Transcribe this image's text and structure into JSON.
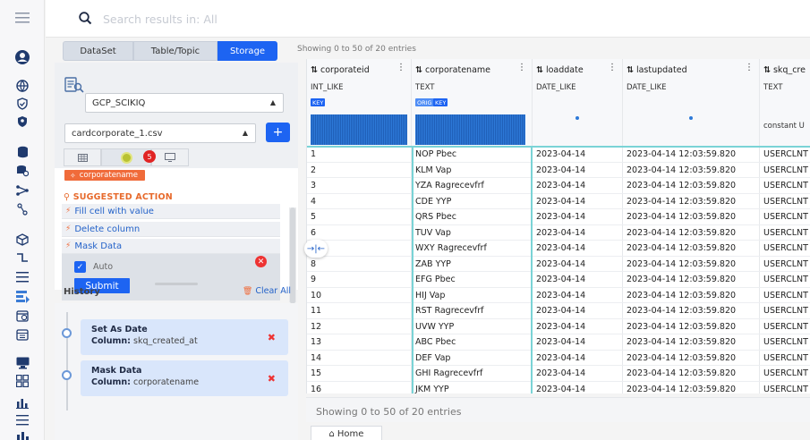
{
  "search": {
    "placeholder": "Search results in: All"
  },
  "panel_tabs": [
    {
      "label": "DataSet",
      "active": false
    },
    {
      "label": "Table/Topic",
      "active": false
    },
    {
      "label": "Storage",
      "active": true
    }
  ],
  "config": {
    "project": "GCP_SCIKIQ",
    "file": "cardcorporate_1.csv",
    "add_label": "+",
    "alert_count": "5"
  },
  "selected_column_chip": "corporatename",
  "suggested_action": {
    "title": "SUGGESTED ACTION",
    "actions": [
      "Fill cell with value",
      "Delete column",
      "Mask Data"
    ],
    "auto_label": "Auto",
    "submit_label": "Submit"
  },
  "history": {
    "title": "History",
    "clear_label": "Clear All",
    "items": [
      {
        "title": "Set As Date",
        "column_label": "Column:",
        "column": "skq_created_at"
      },
      {
        "title": "Mask Data",
        "column_label": "Column:",
        "column": "corporatename"
      }
    ]
  },
  "table": {
    "showing_top": "Showing 0 to 50 of 20 entries",
    "showing_bottom": "Showing 0 to 50 of 20 entries",
    "columns": [
      {
        "name": "corporateid",
        "type": "INT_LIKE",
        "keys": [
          "KEY"
        ]
      },
      {
        "name": "corporatename",
        "type": "TEXT",
        "keys": [
          "ORIG",
          "KEY"
        ]
      },
      {
        "name": "loaddate",
        "type": "DATE_LIKE",
        "keys": []
      },
      {
        "name": "lastupdated",
        "type": "DATE_LIKE",
        "keys": []
      },
      {
        "name": "skq_cre",
        "type": "TEXT",
        "keys": [],
        "profile_text": "constant U"
      }
    ],
    "rows": [
      [
        "1",
        "NOP Pbec",
        "2023-04-14",
        "2023-04-14 12:03:59.820",
        "USERCLNT"
      ],
      [
        "2",
        "KLM Vap",
        "2023-04-14",
        "2023-04-14 12:03:59.820",
        "USERCLNT"
      ],
      [
        "3",
        "YZA Ragrecevfrf",
        "2023-04-14",
        "2023-04-14 12:03:59.820",
        "USERCLNT"
      ],
      [
        "4",
        "CDE YYP",
        "2023-04-14",
        "2023-04-14 12:03:59.820",
        "USERCLNT"
      ],
      [
        "5",
        "QRS Pbec",
        "2023-04-14",
        "2023-04-14 12:03:59.820",
        "USERCLNT"
      ],
      [
        "6",
        "TUV Vap",
        "2023-04-14",
        "2023-04-14 12:03:59.820",
        "USERCLNT"
      ],
      [
        "7",
        "WXY Ragrecevfrf",
        "2023-04-14",
        "2023-04-14 12:03:59.820",
        "USERCLNT"
      ],
      [
        "8",
        "ZAB YYP",
        "2023-04-14",
        "2023-04-14 12:03:59.820",
        "USERCLNT"
      ],
      [
        "9",
        "EFG Pbec",
        "2023-04-14",
        "2023-04-14 12:03:59.820",
        "USERCLNT"
      ],
      [
        "10",
        "HIJ Vap",
        "2023-04-14",
        "2023-04-14 12:03:59.820",
        "USERCLNT"
      ],
      [
        "11",
        "RST Ragrecevfrf",
        "2023-04-14",
        "2023-04-14 12:03:59.820",
        "USERCLNT"
      ],
      [
        "12",
        "UVW YYP",
        "2023-04-14",
        "2023-04-14 12:03:59.820",
        "USERCLNT"
      ],
      [
        "13",
        "ABC Pbec",
        "2023-04-14",
        "2023-04-14 12:03:59.820",
        "USERCLNT"
      ],
      [
        "14",
        "DEF Vap",
        "2023-04-14",
        "2023-04-14 12:03:59.820",
        "USERCLNT"
      ],
      [
        "15",
        "GHI Ragrecevfrf",
        "2023-04-14",
        "2023-04-14 12:03:59.820",
        "USERCLNT"
      ],
      [
        "16",
        "JKM YYP",
        "2023-04-14",
        "2023-04-14 12:03:59.820",
        "USERCLNT"
      ]
    ]
  },
  "bottom_tab": {
    "label": "Home"
  },
  "rail_icons": [
    "menu-icon",
    "user-circle-icon",
    "globe-icon",
    "shield-check-icon",
    "user-shield-icon",
    "database-icon",
    "database-sync-icon",
    "pipeline-icon",
    "flow-icon",
    "cube-icon",
    "connector-icon",
    "list-icon",
    "transform-icon",
    "schedule-icon",
    "calendar-icon",
    "monitor-icon",
    "grid-icon",
    "bar-chart-icon",
    "list-lines-icon",
    "bar-chart-alt-icon"
  ],
  "colors": {
    "primary": "#1d64f2",
    "accent": "#f06b3a",
    "selection": "#7ad3d6"
  }
}
